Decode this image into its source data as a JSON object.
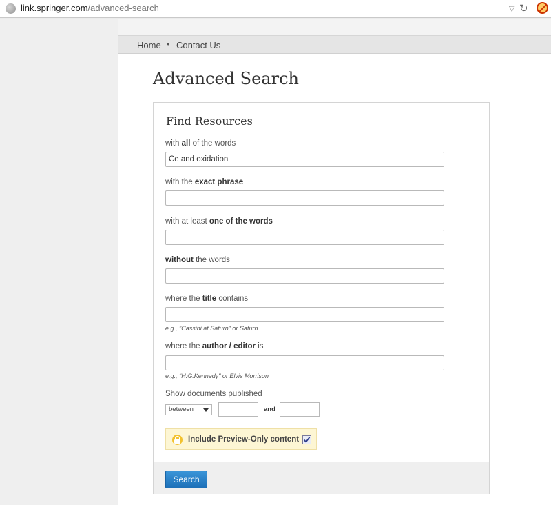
{
  "browser": {
    "url_domain": "link.springer.com",
    "url_path": "/advanced-search"
  },
  "nav": {
    "home": "Home",
    "separator": "•",
    "contact": "Contact Us"
  },
  "page_title": "Advanced Search",
  "form": {
    "heading": "Find Resources",
    "all_words": {
      "pre": "with ",
      "bold": "all",
      "post": " of the words",
      "value": "Ce and oxidation"
    },
    "exact_phrase": {
      "pre": "with the ",
      "bold": "exact phrase",
      "post": "",
      "value": ""
    },
    "one_of": {
      "pre": "with at least ",
      "bold": "one of the words",
      "post": "",
      "value": ""
    },
    "without": {
      "pre": "",
      "bold": "without",
      "post": " the words",
      "value": ""
    },
    "title": {
      "pre": "where the ",
      "bold": "title",
      "post": " contains",
      "value": "",
      "hint": "e.g., \"Cassini at Saturn\" or Saturn"
    },
    "author": {
      "pre": "where the ",
      "bold": "author / editor",
      "post": " is",
      "value": "",
      "hint": "e.g., \"H.G.Kennedy\" or Elvis Morrison"
    },
    "published_label": "Show documents published",
    "date_mode": "between",
    "and_label": "and",
    "preview_pre": "Include ",
    "preview_link": "Preview-Only",
    "preview_post": " content",
    "preview_checked": true,
    "search_button": "Search"
  },
  "colors": {
    "button": "#1d70b8",
    "preview_bg": "#fdf6d4",
    "lock": "#f2c230"
  }
}
